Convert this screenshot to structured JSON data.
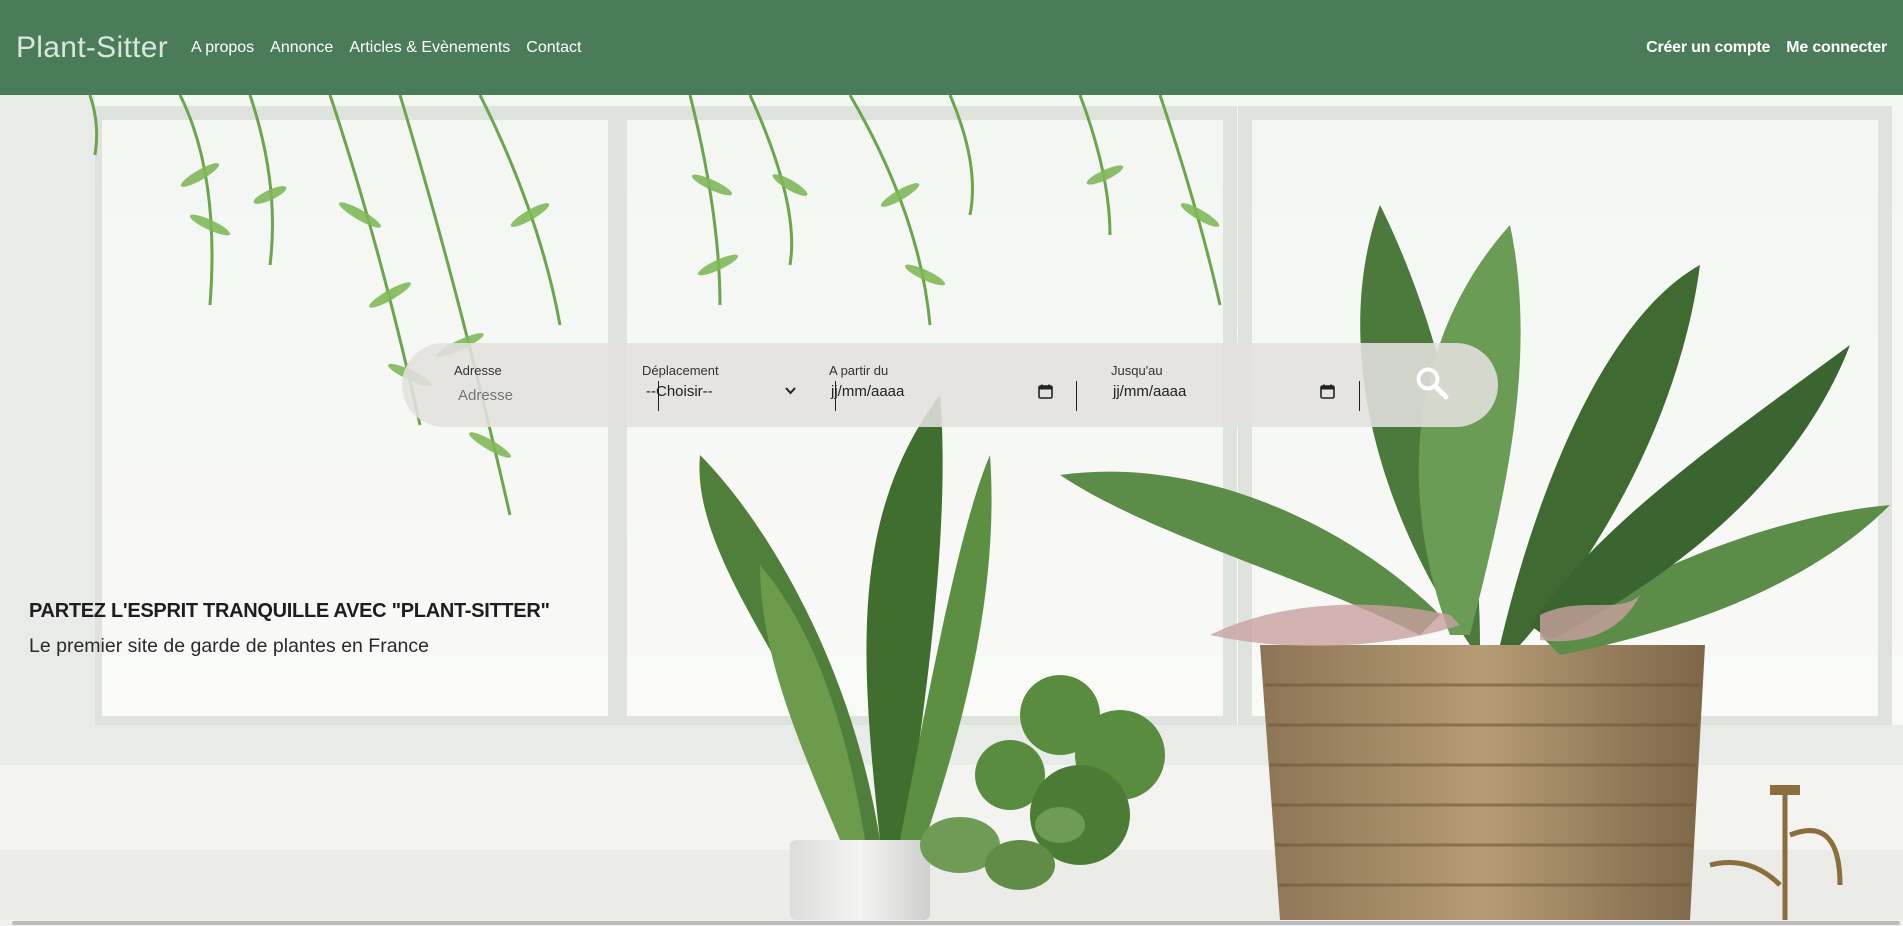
{
  "navbar": {
    "brand": "Plant-Sitter",
    "links": [
      "A propos",
      "Annonce",
      "Articles & Evènements",
      "Contact"
    ],
    "account": {
      "register": "Créer un compte",
      "login": "Me connecter"
    }
  },
  "search": {
    "address": {
      "label": "Adresse",
      "placeholder": "Adresse"
    },
    "travel": {
      "label": "Déplacement",
      "selected": "--Choisir--"
    },
    "from": {
      "label": "A partir du",
      "value": "jj/mm/aaaa"
    },
    "to": {
      "label": "Jusqu'au",
      "value": "jj/mm/aaaa"
    },
    "submit_icon": "search-icon"
  },
  "hero": {
    "headline": "PARTEZ L'ESPRIT TRANQUILLE AVEC \"PLANT-SITTER\"",
    "subline": "Le premier site de garde de plantes en France"
  },
  "colors": {
    "navbar": "#4a7c59",
    "search_bar": "#e2e0de",
    "text_dark": "#1e1e1e"
  }
}
